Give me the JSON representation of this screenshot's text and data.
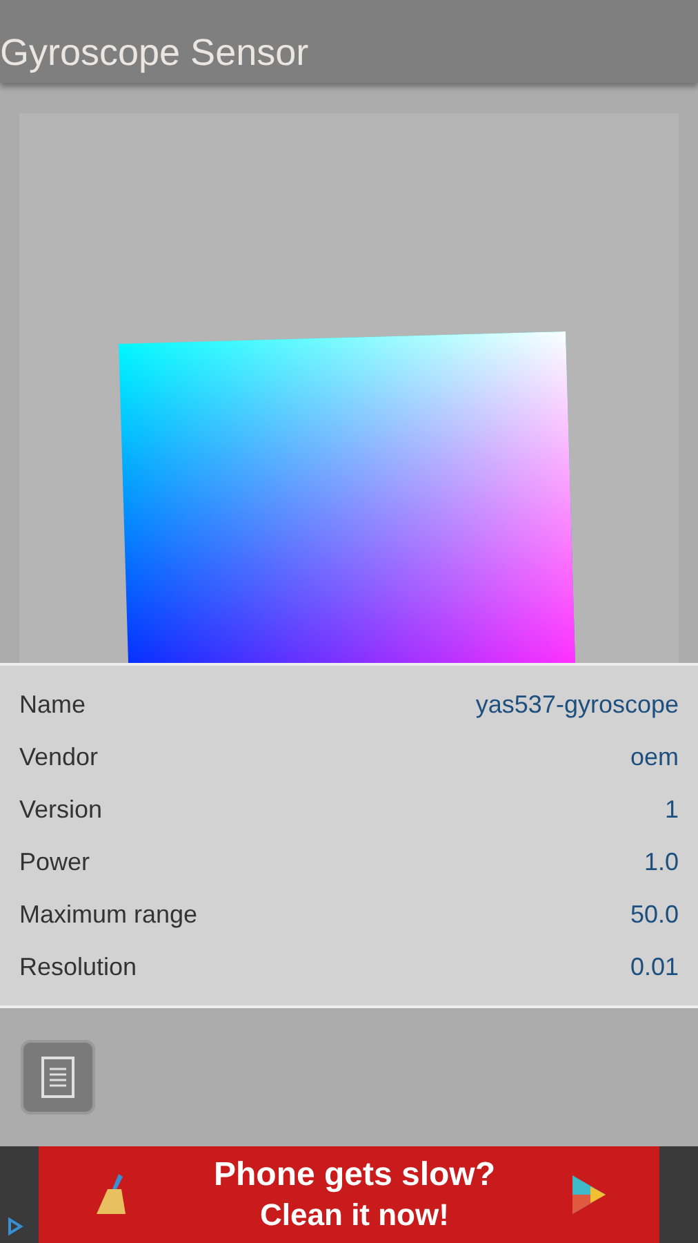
{
  "app_bar": {
    "title": "Gyroscope Sensor"
  },
  "properties": [
    {
      "label": "Name",
      "value": "yas537-gyroscope"
    },
    {
      "label": "Vendor",
      "value": "oem"
    },
    {
      "label": "Version",
      "value": "1"
    },
    {
      "label": "Power",
      "value": "1.0"
    },
    {
      "label": "Maximum range",
      "value": "50.0"
    },
    {
      "label": "Resolution",
      "value": "0.01"
    }
  ],
  "ad_banner": {
    "headline": "Phone gets slow?",
    "subline": "Clean it now!"
  }
}
